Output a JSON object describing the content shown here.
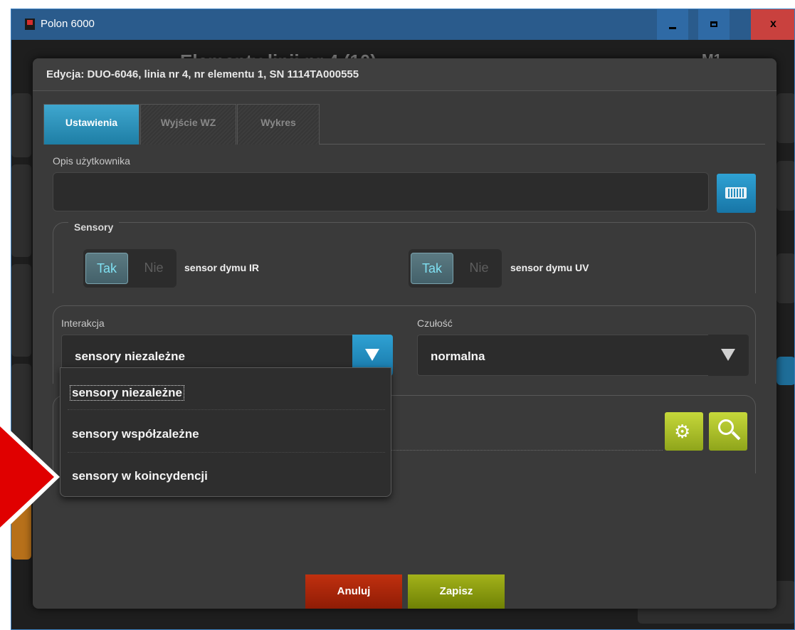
{
  "window": {
    "title": "Polon 6000",
    "close_label": "x"
  },
  "background": {
    "header_text": "Elementy linii nr 4 (10)",
    "m1_label": "M1"
  },
  "dialog": {
    "title": "Edycja: DUO-6046, linia nr 4, nr elementu 1, SN 1114TA000555",
    "tabs": [
      {
        "label": "Ustawienia",
        "active": true
      },
      {
        "label": "Wyjście WZ",
        "active": false
      },
      {
        "label": "Wykres",
        "active": false
      }
    ],
    "user_description": {
      "label": "Opis użytkownika",
      "value": ""
    },
    "sensors": {
      "group_label": "Sensory",
      "ir": {
        "on_label": "Tak",
        "off_label": "Nie",
        "state": "Tak",
        "text": "sensor dymu IR"
      },
      "uv": {
        "on_label": "Tak",
        "off_label": "Nie",
        "state": "Tak",
        "text": "sensor dymu UV"
      }
    },
    "interaction": {
      "label": "Interakcja",
      "value": "sensory niezależne",
      "options": [
        "sensory niezależne",
        "sensory współzależne",
        "sensory w koincydencji"
      ]
    },
    "sensitivity": {
      "label": "Czułość",
      "value": "normalna"
    },
    "buttons": {
      "cancel": "Anuluj",
      "save": "Zapisz"
    }
  },
  "colors": {
    "accent_blue": "#1e7ea5",
    "titlebar": "#2a5b8c",
    "cancel_red": "#a8260a",
    "save_green": "#8a9c10",
    "annotation_red": "#e00000"
  },
  "icons": [
    "app-logo-icon",
    "keyboard-icon",
    "gears-icon",
    "search-icon",
    "dropdown-arrow-icon",
    "annotation-arrow-icon"
  ]
}
